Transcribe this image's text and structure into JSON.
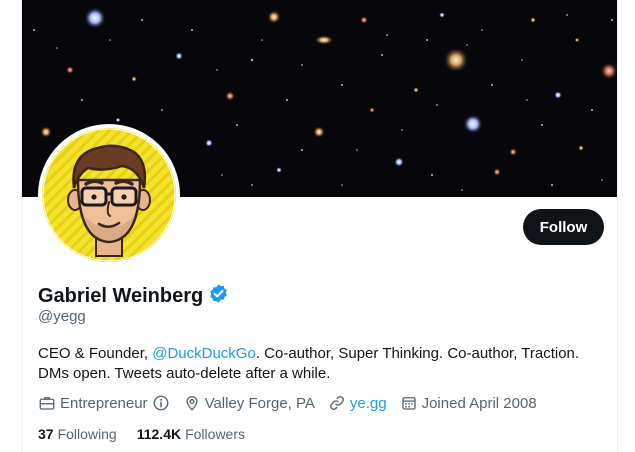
{
  "profile": {
    "display_name": "Gabriel Weinberg",
    "handle": "@yegg",
    "verified": true,
    "follow_label": "Follow",
    "bio": {
      "prefix": "CEO & Founder, ",
      "mention": "@DuckDuckGo",
      "rest": ". Co-author, Super Thinking. Co-author, Traction.",
      "line2": "DMs open. Tweets auto-delete after a while."
    },
    "meta": {
      "category": "Entrepreneur",
      "location": "Valley Forge, PA",
      "website": "ye.gg",
      "joined": "Joined April 2008"
    },
    "stats": {
      "following_count": "37",
      "following_label": "Following",
      "followers_count": "112.4K",
      "followers_label": "Followers"
    }
  },
  "colors": {
    "accent": "#1d9bf0",
    "text_primary": "#0f1419",
    "text_secondary": "#536471",
    "button_bg": "#0f1419",
    "avatar_bg": "#f5e22a"
  },
  "icons": {
    "verified": "verified-badge-icon",
    "category": "briefcase-icon",
    "info": "info-icon",
    "location": "location-pin-icon",
    "link": "link-icon",
    "calendar": "calendar-icon"
  }
}
